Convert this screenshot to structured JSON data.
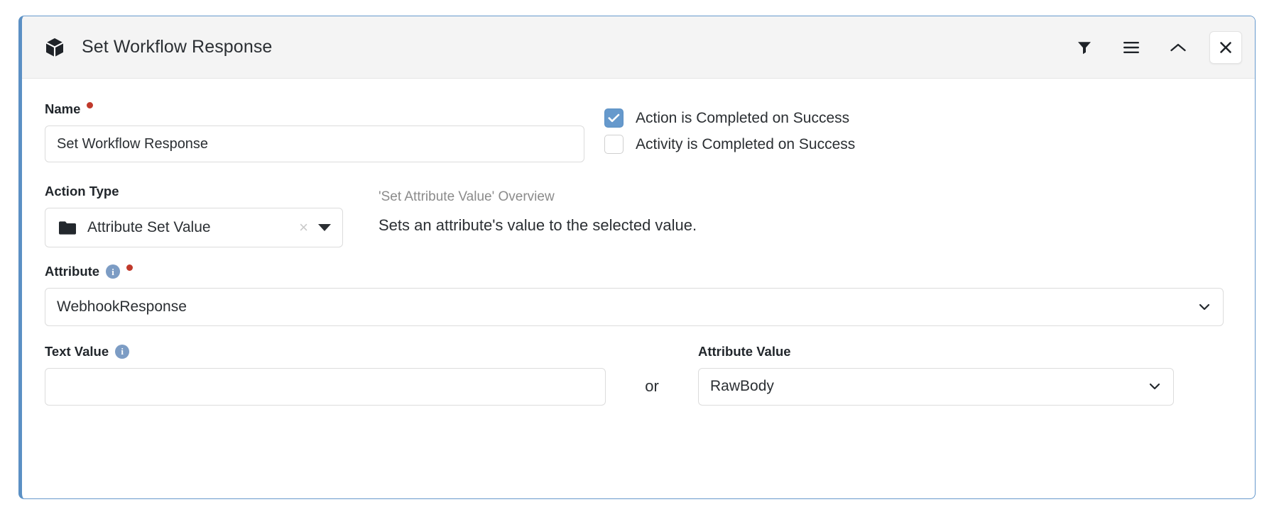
{
  "card": {
    "header": {
      "icon": "cube-icon",
      "title": "Set Workflow Response",
      "buttons": [
        {
          "name": "filter-icon",
          "label": "Filter"
        },
        {
          "name": "menu-icon",
          "label": "Menu"
        },
        {
          "name": "chevron-up-icon",
          "label": "Collapse"
        },
        {
          "name": "close-icon",
          "label": "Close"
        }
      ]
    },
    "accent_color": "#6699cc",
    "header_background": "#f4f4f4"
  },
  "fields": {
    "name": {
      "label": "Name",
      "required": true,
      "value": "Set Workflow Response",
      "placeholder": ""
    },
    "checkboxes": [
      {
        "label": "Action is Completed on Success",
        "checked": true
      },
      {
        "label": "Activity is Completed on Success",
        "checked": false
      }
    ],
    "action_type": {
      "label": "Action Type",
      "value": "Attribute Set Value",
      "clear_label": "×",
      "icon": "folder-icon"
    },
    "overview": {
      "title": "'Set Attribute Value' Overview",
      "description": "Sets an attribute's value to the selected value."
    },
    "attribute": {
      "label": "Attribute",
      "required": true,
      "info": "i",
      "value": "WebhookResponse"
    },
    "text_value": {
      "label": "Text Value",
      "info": "i",
      "value": "",
      "placeholder": ""
    },
    "separator": "or",
    "attribute_value": {
      "label": "Attribute Value",
      "value": "RawBody"
    }
  },
  "colors": {
    "required_dot": "#c0392b",
    "info_icon": "#7c9cc4",
    "checkbox_checked": "#6699cc",
    "border": "#dcdcdc"
  }
}
